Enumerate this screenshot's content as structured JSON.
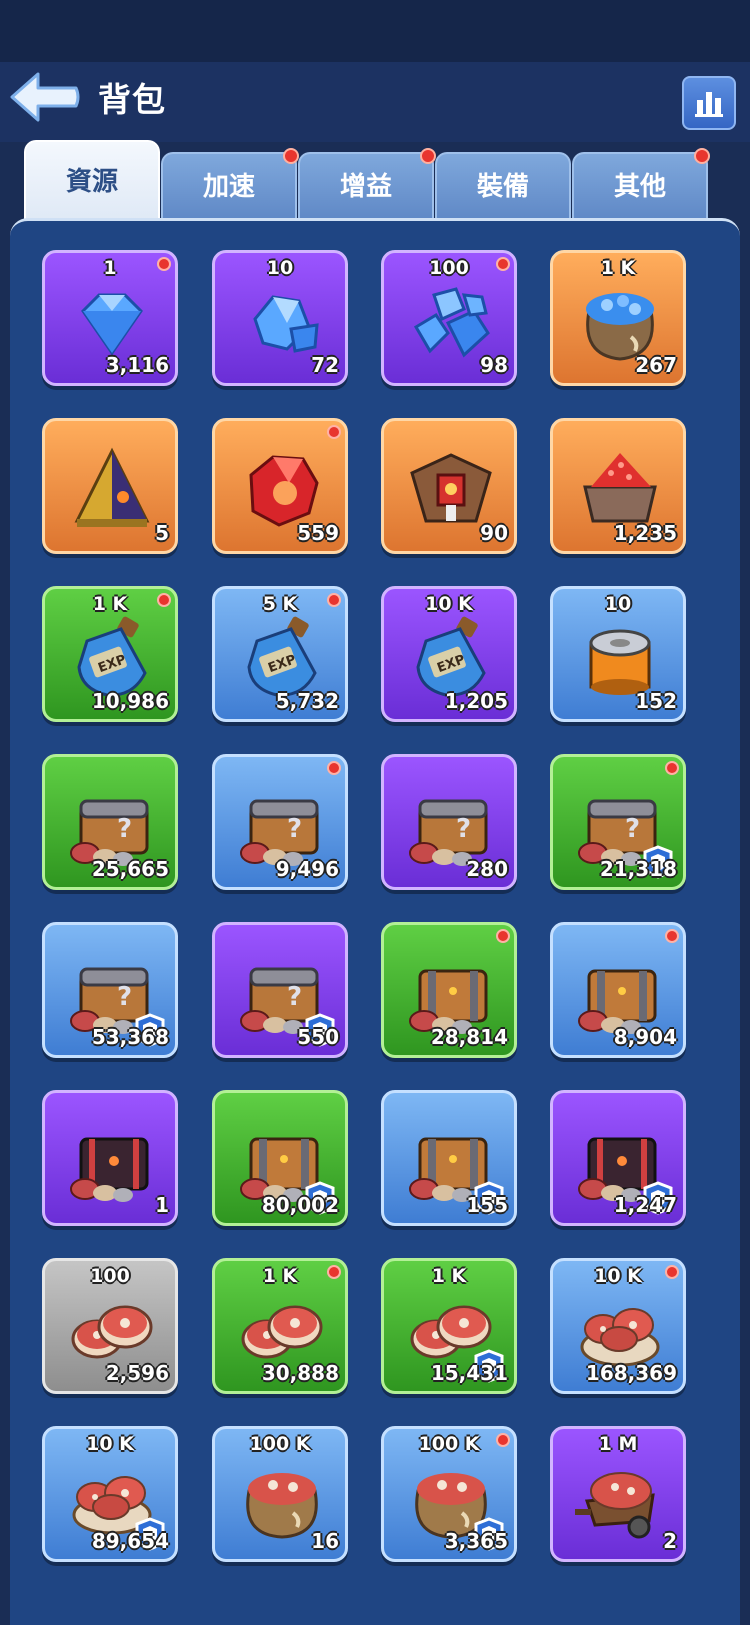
{
  "header": {
    "title": "背包"
  },
  "tabs": [
    {
      "label": "資源",
      "active": true,
      "dot": false
    },
    {
      "label": "加速",
      "active": false,
      "dot": true
    },
    {
      "label": "增益",
      "active": false,
      "dot": true
    },
    {
      "label": "裝備",
      "active": false,
      "dot": false
    },
    {
      "label": "其他",
      "active": false,
      "dot": true
    }
  ],
  "items": [
    {
      "icon": "gem-single-icon",
      "rarity": "purple",
      "top": "1",
      "count": "3,116",
      "dot": true,
      "shield": false
    },
    {
      "icon": "gem-cluster-small-icon",
      "rarity": "purple",
      "top": "10",
      "count": "72",
      "dot": false,
      "shield": false
    },
    {
      "icon": "gem-pile-icon",
      "rarity": "purple",
      "top": "100",
      "count": "98",
      "dot": true,
      "shield": false
    },
    {
      "icon": "gem-sack-icon",
      "rarity": "orange",
      "top": "1 K",
      "count": "267",
      "dot": false,
      "shield": false
    },
    {
      "icon": "pyramid-icon",
      "rarity": "orange",
      "top": "",
      "count": "5",
      "dot": false,
      "shield": false
    },
    {
      "icon": "red-crystal-icon",
      "rarity": "orange",
      "top": "",
      "count": "559",
      "dot": true,
      "shield": false
    },
    {
      "icon": "altar-icon",
      "rarity": "orange",
      "top": "",
      "count": "90",
      "dot": false,
      "shield": false
    },
    {
      "icon": "ore-cart-icon",
      "rarity": "orange",
      "top": "",
      "count": "1,235",
      "dot": false,
      "shield": false
    },
    {
      "icon": "exp-potion-icon",
      "rarity": "green",
      "top": "1 K",
      "count": "10,986",
      "dot": true,
      "shield": false
    },
    {
      "icon": "exp-potion-icon",
      "rarity": "blue",
      "top": "5 K",
      "count": "5,732",
      "dot": true,
      "shield": false
    },
    {
      "icon": "exp-potion-icon",
      "rarity": "purple",
      "top": "10 K",
      "count": "1,205",
      "dot": false,
      "shield": false
    },
    {
      "icon": "tin-can-icon",
      "rarity": "blue",
      "top": "10",
      "count": "152",
      "dot": false,
      "shield": false
    },
    {
      "icon": "mystery-chest-icon",
      "rarity": "green",
      "top": "",
      "count": "25,665",
      "dot": false,
      "shield": false
    },
    {
      "icon": "mystery-chest-icon",
      "rarity": "blue",
      "top": "",
      "count": "9,496",
      "dot": true,
      "shield": false
    },
    {
      "icon": "mystery-chest-icon",
      "rarity": "purple",
      "top": "",
      "count": "280",
      "dot": false,
      "shield": false
    },
    {
      "icon": "mystery-chest-icon",
      "rarity": "green",
      "top": "",
      "count": "21,318",
      "dot": true,
      "shield": true
    },
    {
      "icon": "mystery-chest-icon",
      "rarity": "blue",
      "top": "",
      "count": "53,368",
      "dot": false,
      "shield": true
    },
    {
      "icon": "mystery-chest-icon",
      "rarity": "purple",
      "top": "",
      "count": "550",
      "dot": false,
      "shield": true
    },
    {
      "icon": "treasure-chest-icon",
      "rarity": "green",
      "top": "",
      "count": "28,814",
      "dot": true,
      "shield": false
    },
    {
      "icon": "treasure-chest-icon",
      "rarity": "blue",
      "top": "",
      "count": "8,904",
      "dot": true,
      "shield": false
    },
    {
      "icon": "dark-chest-icon",
      "rarity": "purple",
      "top": "",
      "count": "1",
      "dot": false,
      "shield": false
    },
    {
      "icon": "treasure-chest-icon",
      "rarity": "green",
      "top": "",
      "count": "80,002",
      "dot": false,
      "shield": true
    },
    {
      "icon": "treasure-chest-icon",
      "rarity": "blue",
      "top": "",
      "count": "155",
      "dot": false,
      "shield": true
    },
    {
      "icon": "dark-chest-icon",
      "rarity": "purple",
      "top": "",
      "count": "1,247",
      "dot": false,
      "shield": true
    },
    {
      "icon": "meat-icon",
      "rarity": "gray",
      "top": "100",
      "count": "2,596",
      "dot": false,
      "shield": false
    },
    {
      "icon": "meat-icon",
      "rarity": "green",
      "top": "1 K",
      "count": "30,888",
      "dot": true,
      "shield": false
    },
    {
      "icon": "meat-icon",
      "rarity": "green",
      "top": "1 K",
      "count": "15,431",
      "dot": false,
      "shield": true
    },
    {
      "icon": "meat-pile-icon",
      "rarity": "blue",
      "top": "10 K",
      "count": "168,369",
      "dot": true,
      "shield": false
    },
    {
      "icon": "meat-pile-icon",
      "rarity": "blue",
      "top": "10 K",
      "count": "89,654",
      "dot": false,
      "shield": true
    },
    {
      "icon": "meat-sack-icon",
      "rarity": "blue",
      "top": "100 K",
      "count": "16",
      "dot": false,
      "shield": false
    },
    {
      "icon": "meat-sack-icon",
      "rarity": "blue",
      "top": "100 K",
      "count": "3,365",
      "dot": true,
      "shield": true
    },
    {
      "icon": "meat-cart-icon",
      "rarity": "purple",
      "top": "1 M",
      "count": "2",
      "dot": false,
      "shield": false
    }
  ]
}
